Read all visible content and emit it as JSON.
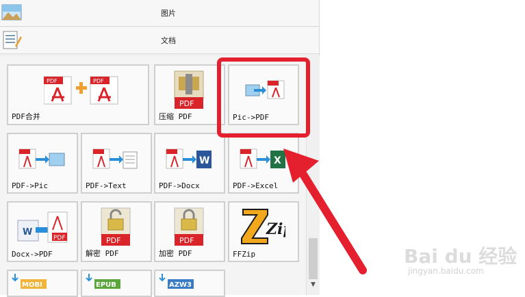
{
  "categories": [
    {
      "label": "图片",
      "icon": "picture-icon"
    },
    {
      "label": "文档",
      "icon": "document-icon"
    }
  ],
  "tiles": [
    {
      "label": "PDF合并",
      "icon": "pdf-merge-icon"
    },
    {
      "label": "压缩 PDF",
      "icon": "pdf-compress-icon"
    },
    {
      "label": "Pic->PDF",
      "icon": "pic-to-pdf-icon"
    },
    {
      "label": "PDF->Pic",
      "icon": "pdf-to-pic-icon"
    },
    {
      "label": "PDF->Text",
      "icon": "pdf-to-text-icon"
    },
    {
      "label": "PDF->Docx",
      "icon": "pdf-to-docx-icon"
    },
    {
      "label": "PDF->Excel",
      "icon": "pdf-to-excel-icon"
    },
    {
      "label": "Docx->PDF",
      "icon": "docx-to-pdf-icon"
    },
    {
      "label": "解密 PDF",
      "icon": "pdf-decrypt-icon"
    },
    {
      "label": "加密 PDF",
      "icon": "pdf-encrypt-icon"
    },
    {
      "label": "FFZip",
      "icon": "ffzip-icon"
    },
    {
      "label": "",
      "icon": "mobi-icon",
      "badge": "MOBI"
    },
    {
      "label": "",
      "icon": "epub-icon",
      "badge": "EPUB"
    },
    {
      "label": "",
      "icon": "azw3-icon",
      "badge": "AZW3"
    }
  ],
  "icon_text": {
    "pdf": "PDF",
    "docx": "W",
    "excel": "X",
    "zip": "Zip"
  },
  "watermark": {
    "main": "Bai du 经验",
    "sub": "jingyan.baidu.com"
  },
  "colors": {
    "highlight": "#e5202e",
    "pdf_red": "#d9252a",
    "arrow_blue": "#2a8fd8"
  }
}
